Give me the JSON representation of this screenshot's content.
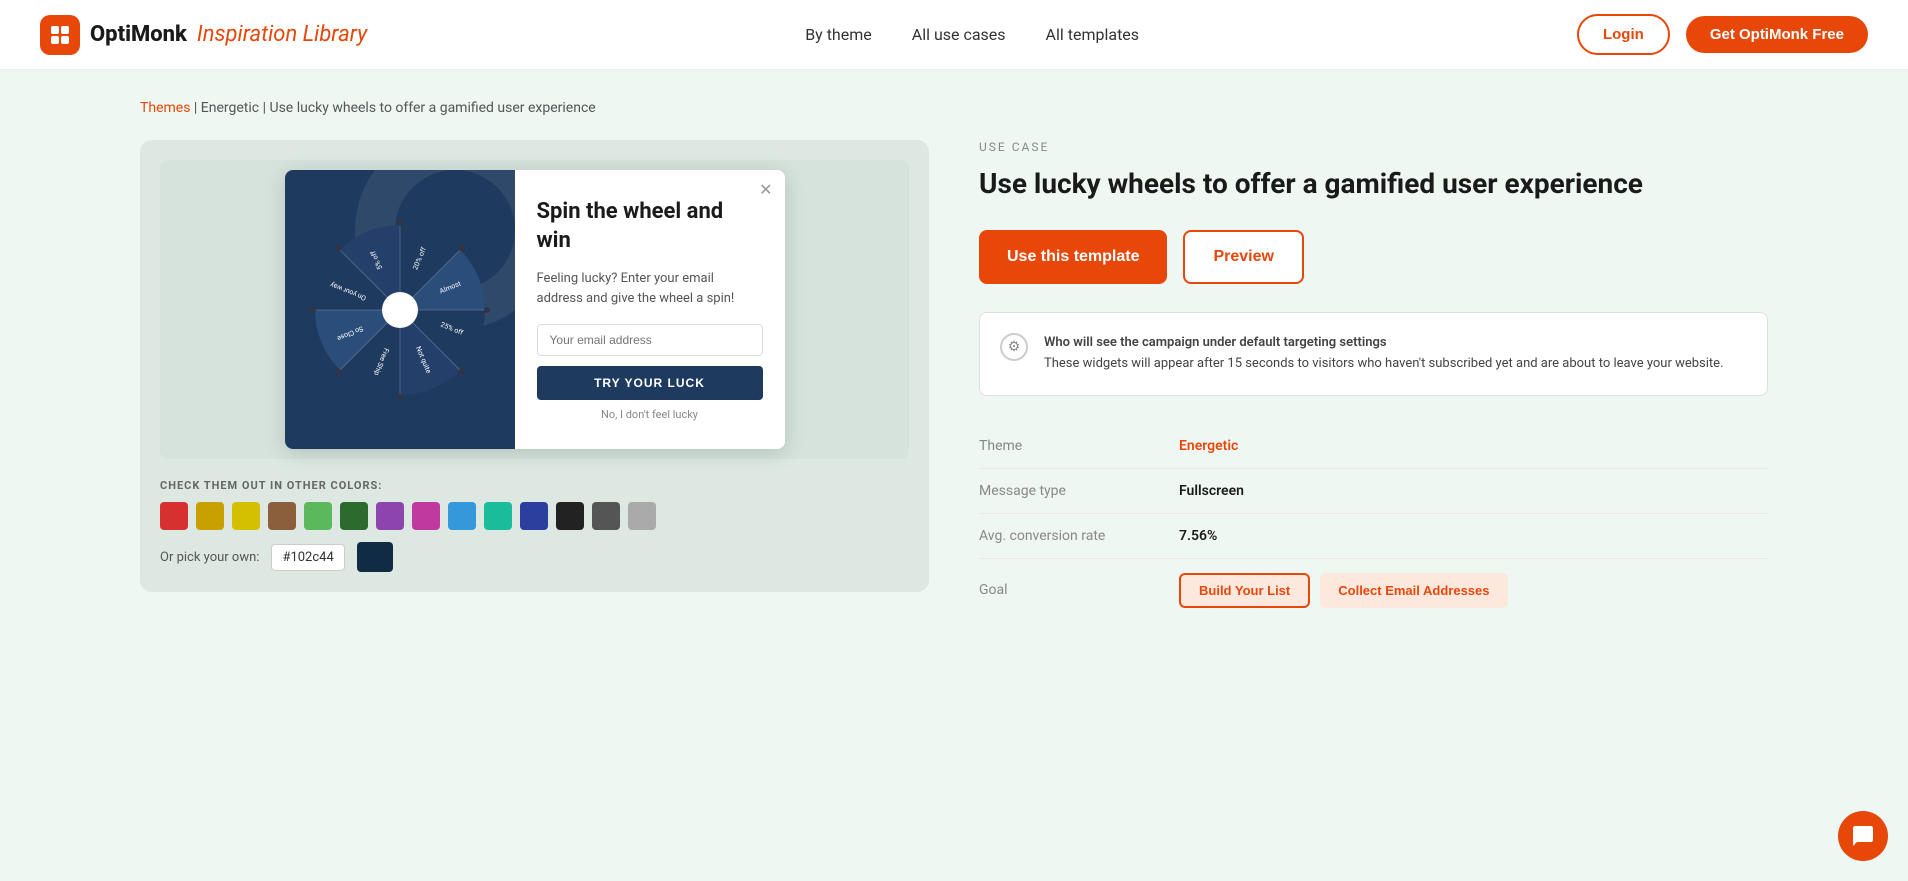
{
  "header": {
    "logo_brand": "OptiMonk",
    "logo_subtitle": "Inspiration Library",
    "nav": {
      "by_theme": "By theme",
      "all_use_cases": "All use cases",
      "all_templates": "All templates"
    },
    "login_label": "Login",
    "get_free_label": "Get OptiMonk Free"
  },
  "breadcrumb": {
    "themes_label": "Themes",
    "energetic_label": "Energetic",
    "current_page": "Use lucky wheels to offer a gamified user experience"
  },
  "preview": {
    "check_colors_label": "CHECK THEM OUT IN OTHER COLORS:",
    "pick_own_label": "Or pick your own:",
    "color_input_value": "#102c44",
    "swatches": [
      {
        "color": "#d63031",
        "name": "red"
      },
      {
        "color": "#c8a000",
        "name": "gold"
      },
      {
        "color": "#d4c000",
        "name": "yellow"
      },
      {
        "color": "#8B5E3C",
        "name": "brown"
      },
      {
        "color": "#5cb85c",
        "name": "light-green"
      },
      {
        "color": "#2d6a2d",
        "name": "dark-green"
      },
      {
        "color": "#8e44ad",
        "name": "purple"
      },
      {
        "color": "#c0399e",
        "name": "pink"
      },
      {
        "color": "#3498db",
        "name": "light-blue"
      },
      {
        "color": "#1abc9c",
        "name": "teal"
      },
      {
        "color": "#2c3e9e",
        "name": "blue"
      },
      {
        "color": "#222222",
        "name": "black"
      },
      {
        "color": "#555555",
        "name": "dark-gray"
      },
      {
        "color": "#aaaaaa",
        "name": "light-gray"
      }
    ]
  },
  "popup": {
    "title": "Spin the wheel and win",
    "subtitle": "Feeling lucky? Enter your email address and give the wheel a spin!",
    "input_placeholder": "Your email address",
    "btn_label": "TRY YOUR LUCK",
    "skip_label": "No, I don't feel lucky",
    "wheel_segments": [
      {
        "label": "20% off",
        "color": "#1e3a5f"
      },
      {
        "label": "Almost",
        "color": "#2a4d7a"
      },
      {
        "label": "25% off",
        "color": "#1e3a5f"
      },
      {
        "label": "Not quite",
        "color": "#2a4d7a"
      },
      {
        "label": "Free Shipping",
        "color": "#1e3a5f"
      },
      {
        "label": "So Close",
        "color": "#2a4d7a"
      },
      {
        "label": "On your way",
        "color": "#1e3a5f"
      },
      {
        "label": "5% off",
        "color": "#2a4d7a"
      }
    ]
  },
  "details": {
    "use_case_label": "USE CASE",
    "title": "Use lucky wheels to offer a gamified user experience",
    "use_template_btn": "Use this template",
    "preview_btn": "Preview",
    "info_bold": "Who will see the campaign under default targeting settings",
    "info_text": "These widgets will appear after 15 seconds to visitors who haven't subscribed yet and are about to leave your website.",
    "theme_label": "Theme",
    "theme_value": "Energetic",
    "message_type_label": "Message type",
    "message_type_value": "Fullscreen",
    "conversion_rate_label": "Avg. conversion rate",
    "conversion_rate_value": "7.56%",
    "goal_label": "Goal",
    "goal_btn1": "Build Your List",
    "goal_btn2": "Collect Email Addresses"
  }
}
